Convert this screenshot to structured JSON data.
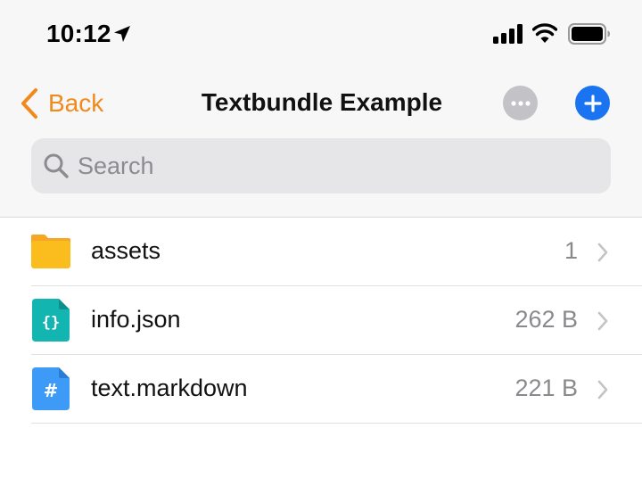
{
  "status_bar": {
    "time": "10:12"
  },
  "nav": {
    "back_label": "Back",
    "title": "Textbundle Example",
    "accent_color": "#f08a1c",
    "add_color": "#1a73f0"
  },
  "search": {
    "placeholder": "Search",
    "value": ""
  },
  "files": [
    {
      "name": "assets",
      "meta": "1",
      "icon": "folder-icon"
    },
    {
      "name": "info.json",
      "meta": "262 B",
      "icon": "json-file-icon"
    },
    {
      "name": "text.markdown",
      "meta": "221 B",
      "icon": "markdown-file-icon"
    }
  ]
}
